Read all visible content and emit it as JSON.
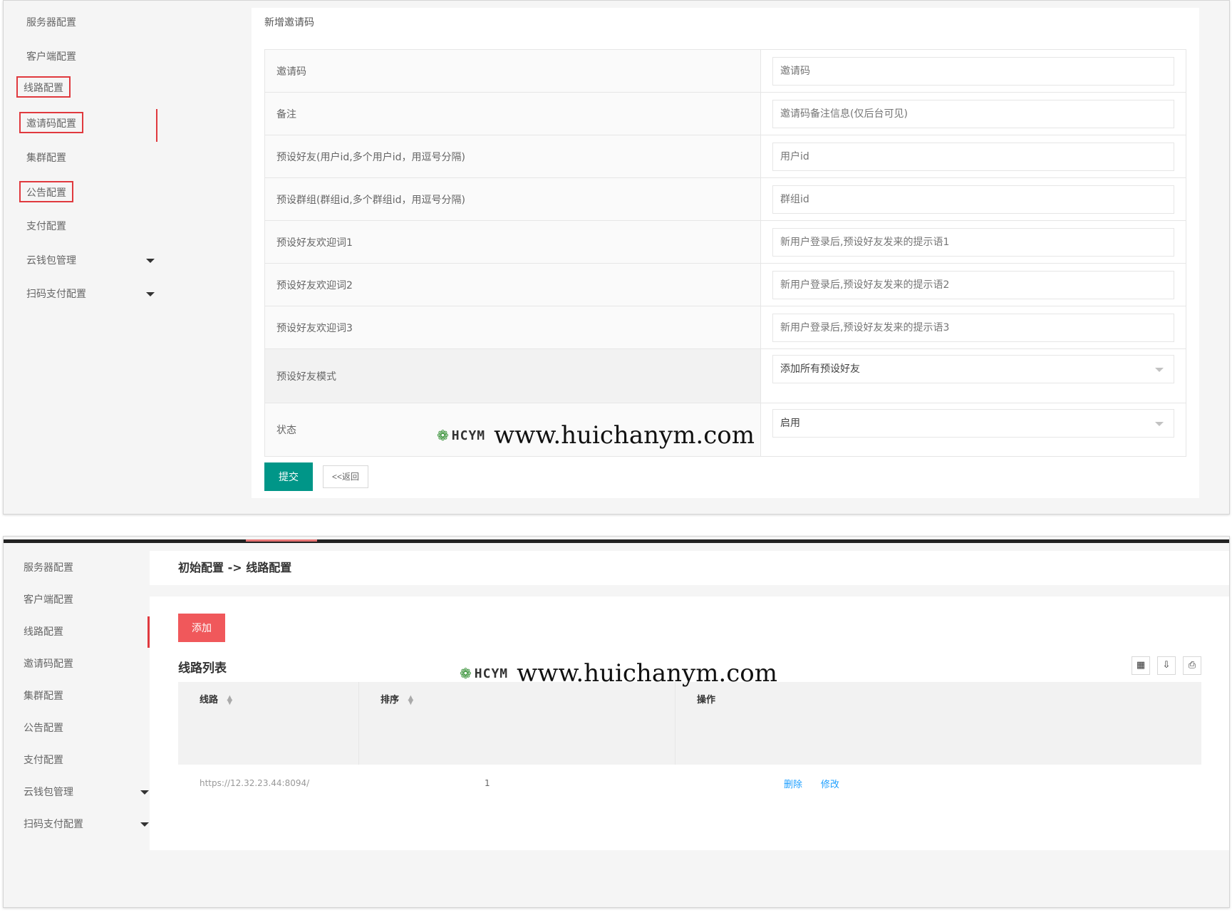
{
  "panel1": {
    "sidebar": [
      {
        "label": "服务器配置"
      },
      {
        "label": "客户端配置"
      },
      {
        "label": "线路配置"
      },
      {
        "label": "邀请码配置"
      },
      {
        "label": "集群配置"
      },
      {
        "label": "公告配置"
      },
      {
        "label": "支付配置"
      },
      {
        "label": "云钱包管理"
      },
      {
        "label": "扫码支付配置"
      }
    ],
    "title": "新增邀请码",
    "fields": [
      {
        "label": "邀请码",
        "placeholder": "邀请码"
      },
      {
        "label": "备注",
        "placeholder": "邀请码备注信息(仅后台可见)"
      },
      {
        "label": "预设好友(用户id,多个用户id，用逗号分隔)",
        "placeholder": "用户id"
      },
      {
        "label": "预设群组(群组id,多个群组id，用逗号分隔)",
        "placeholder": "群组id"
      },
      {
        "label": "预设好友欢迎词1",
        "placeholder": "新用户登录后,预设好友发来的提示语1"
      },
      {
        "label": "预设好友欢迎词2",
        "placeholder": "新用户登录后,预设好友发来的提示语2"
      },
      {
        "label": "预设好友欢迎词3",
        "placeholder": "新用户登录后,预设好友发来的提示语3"
      }
    ],
    "mode": {
      "label": "预设好友模式",
      "value": "添加所有预设好友"
    },
    "status": {
      "label": "状态",
      "value": "启用"
    },
    "submit_label": "提交",
    "back_label": "<<返回"
  },
  "panel2": {
    "sidebar": [
      {
        "label": "服务器配置"
      },
      {
        "label": "客户端配置"
      },
      {
        "label": "线路配置"
      },
      {
        "label": "邀请码配置"
      },
      {
        "label": "集群配置"
      },
      {
        "label": "公告配置"
      },
      {
        "label": "支付配置"
      },
      {
        "label": "云钱包管理"
      },
      {
        "label": "扫码支付配置"
      }
    ],
    "breadcrumb": "初始配置 -> 线路配置",
    "add_label": "添加",
    "list_title": "线路列表",
    "columns": [
      "线路",
      "排序",
      "操作"
    ],
    "rows": [
      {
        "line": "https://12.32.23.44:8094/",
        "sort": "1",
        "delete": "删除",
        "edit": "修改"
      }
    ]
  },
  "watermark": {
    "logo": "HCYM",
    "url": "www.huichanym.com"
  },
  "colors": {
    "accent_teal": "#009688",
    "accent_red": "#f0585b",
    "link_blue": "#1e9fff",
    "highlight_red": "#e0393e"
  }
}
